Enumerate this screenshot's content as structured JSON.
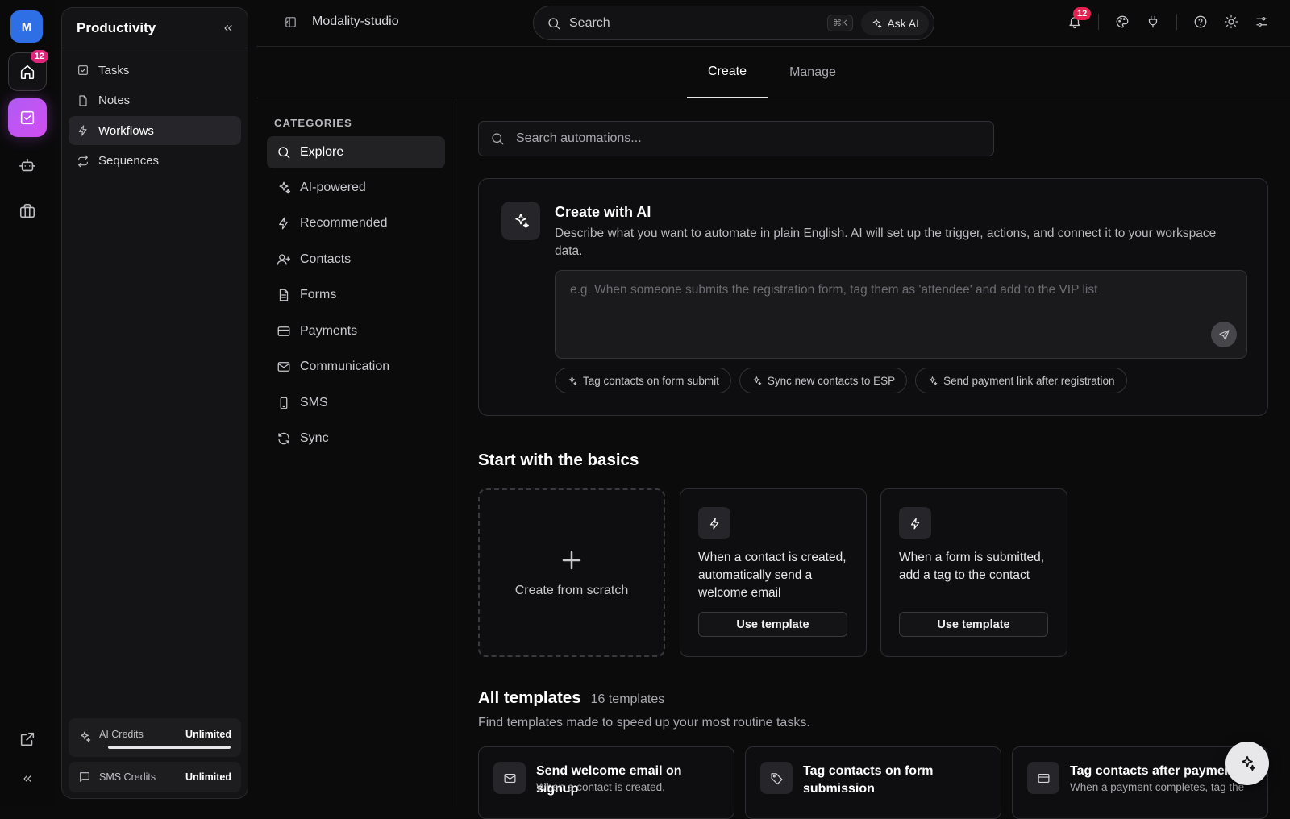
{
  "rail": {
    "avatar": "M",
    "home_badge": "12"
  },
  "sidebar": {
    "title": "Productivity",
    "items": [
      {
        "label": "Tasks",
        "icon": "check-square-icon"
      },
      {
        "label": "Notes",
        "icon": "file-icon"
      },
      {
        "label": "Workflows",
        "icon": "lightning-icon",
        "active": true
      },
      {
        "label": "Sequences",
        "icon": "repeat-icon"
      }
    ],
    "credits": {
      "ai_label": "AI Credits",
      "ai_value": "Unlimited",
      "ai_fill": 1.0,
      "sms_label": "SMS Credits",
      "sms_value": "Unlimited"
    }
  },
  "topbar": {
    "project": "Modality-studio",
    "search_placeholder": "Search",
    "shortcut": "⌘K",
    "ask_ai": "Ask AI",
    "notifications": "12"
  },
  "tabs": [
    {
      "label": "Create",
      "active": true
    },
    {
      "label": "Manage",
      "active": false
    }
  ],
  "categories": {
    "title": "CATEGORIES",
    "items": [
      {
        "label": "Explore",
        "icon": "search-icon",
        "active": true
      },
      {
        "label": "AI-powered",
        "icon": "sparkles-icon"
      },
      {
        "label": "Recommended",
        "icon": "lightning-icon"
      },
      {
        "label": "Contacts",
        "icon": "user-plus-icon"
      },
      {
        "label": "Forms",
        "icon": "document-icon"
      },
      {
        "label": "Payments",
        "icon": "credit-card-icon"
      },
      {
        "label": "Communication",
        "icon": "mail-icon"
      },
      {
        "label": "SMS",
        "icon": "phone-icon"
      },
      {
        "label": "Sync",
        "icon": "refresh-icon"
      }
    ]
  },
  "main": {
    "search_placeholder": "Search automations...",
    "ai_card": {
      "title": "Create with AI",
      "description": "Describe what you want to automate in plain English. AI will set up the trigger, actions, and connect it to your workspace data.",
      "prompt_placeholder": "e.g. When someone submits the registration form, tag them as 'attendee' and add to the VIP list",
      "chips": [
        "Tag contacts on form submit",
        "Sync new contacts to ESP",
        "Send payment link after registration"
      ]
    },
    "basics": {
      "title": "Start with the basics",
      "scratch_label": "Create from scratch",
      "templates": [
        {
          "text": "When a contact is created, automatically send a welcome email",
          "button": "Use template"
        },
        {
          "text": "When a form is submitted, add a tag to the contact",
          "button": "Use template"
        }
      ]
    },
    "all_templates": {
      "title": "All templates",
      "count": "16 templates",
      "subtitle": "Find templates made to speed up your most routine tasks.",
      "cards": [
        {
          "title": "Send welcome email on signup",
          "desc": "When a contact is created,",
          "icon": "mail-icon"
        },
        {
          "title": "Tag contacts on form submission",
          "desc": "",
          "icon": "tag-icon"
        },
        {
          "title": "Tag contacts after payment",
          "desc": "When a payment completes, tag the",
          "icon": "credit-card-icon"
        }
      ]
    }
  }
}
